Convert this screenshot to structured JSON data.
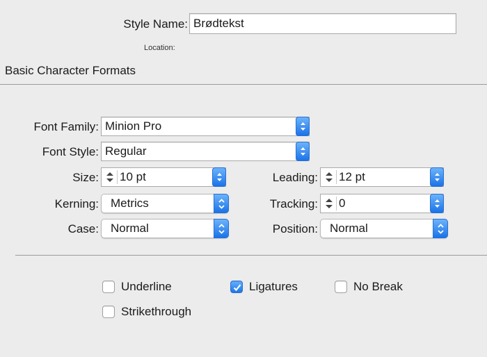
{
  "header": {
    "style_name_label": "Style Name:",
    "style_name_value": "Brødtekst",
    "location_label": "Location:"
  },
  "section": {
    "title": "Basic Character Formats"
  },
  "fields": {
    "font_family_label": "Font Family:",
    "font_family_value": "Minion Pro",
    "font_style_label": "Font Style:",
    "font_style_value": "Regular",
    "size_label": "Size:",
    "size_value": "10 pt",
    "leading_label": "Leading:",
    "leading_value": "12 pt",
    "kerning_label": "Kerning:",
    "kerning_value": "Metrics",
    "tracking_label": "Tracking:",
    "tracking_value": "0",
    "case_label": "Case:",
    "case_value": "Normal",
    "position_label": "Position:",
    "position_value": "Normal"
  },
  "checkboxes": {
    "underline_label": "Underline",
    "underline_checked": false,
    "ligatures_label": "Ligatures",
    "ligatures_checked": true,
    "nobreak_label": "No Break",
    "nobreak_checked": false,
    "strikethrough_label": "Strikethrough",
    "strikethrough_checked": false
  },
  "colors": {
    "background": "#ececec",
    "accent": "#1a73e8"
  }
}
